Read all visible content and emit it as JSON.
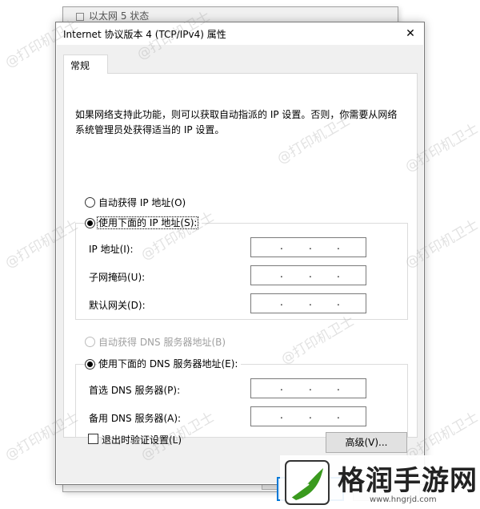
{
  "back_window": {
    "title": "以太网 5 状态"
  },
  "dialog": {
    "title": "Internet 协议版本 4 (TCP/IPv4) 属性",
    "close_glyph": "✕",
    "tab_label": "常规",
    "description": "如果网络支持此功能，则可以获取自动指派的 IP 设置。否则，你需要从网络系统管理员处获得适当的 IP 设置。",
    "ip_section": {
      "auto_label": "自动获得 IP 地址(O)",
      "manual_label": "使用下面的 IP 地址(S):",
      "selected": "manual",
      "fields": [
        {
          "label": "IP 地址(I):",
          "value": ""
        },
        {
          "label": "子网掩码(U):",
          "value": ""
        },
        {
          "label": "默认网关(D):",
          "value": ""
        }
      ]
    },
    "dns_section": {
      "auto_label": "自动获得 DNS 服务器地址(B)",
      "auto_disabled": true,
      "manual_label": "使用下面的 DNS 服务器地址(E):",
      "selected": "manual",
      "fields": [
        {
          "label": "首选 DNS 服务器(P):",
          "value": ""
        },
        {
          "label": "备用 DNS 服务器(A):",
          "value": ""
        }
      ]
    },
    "validate_label": "退出时验证设置(L)",
    "validate_checked": false,
    "advanced_label": "高级(V)..."
  },
  "watermark_text": "@打印机卫士",
  "logo": {
    "name": "格润手游网",
    "url": "www.hngrjd.com",
    "accent_color": "#3a9a1e"
  }
}
